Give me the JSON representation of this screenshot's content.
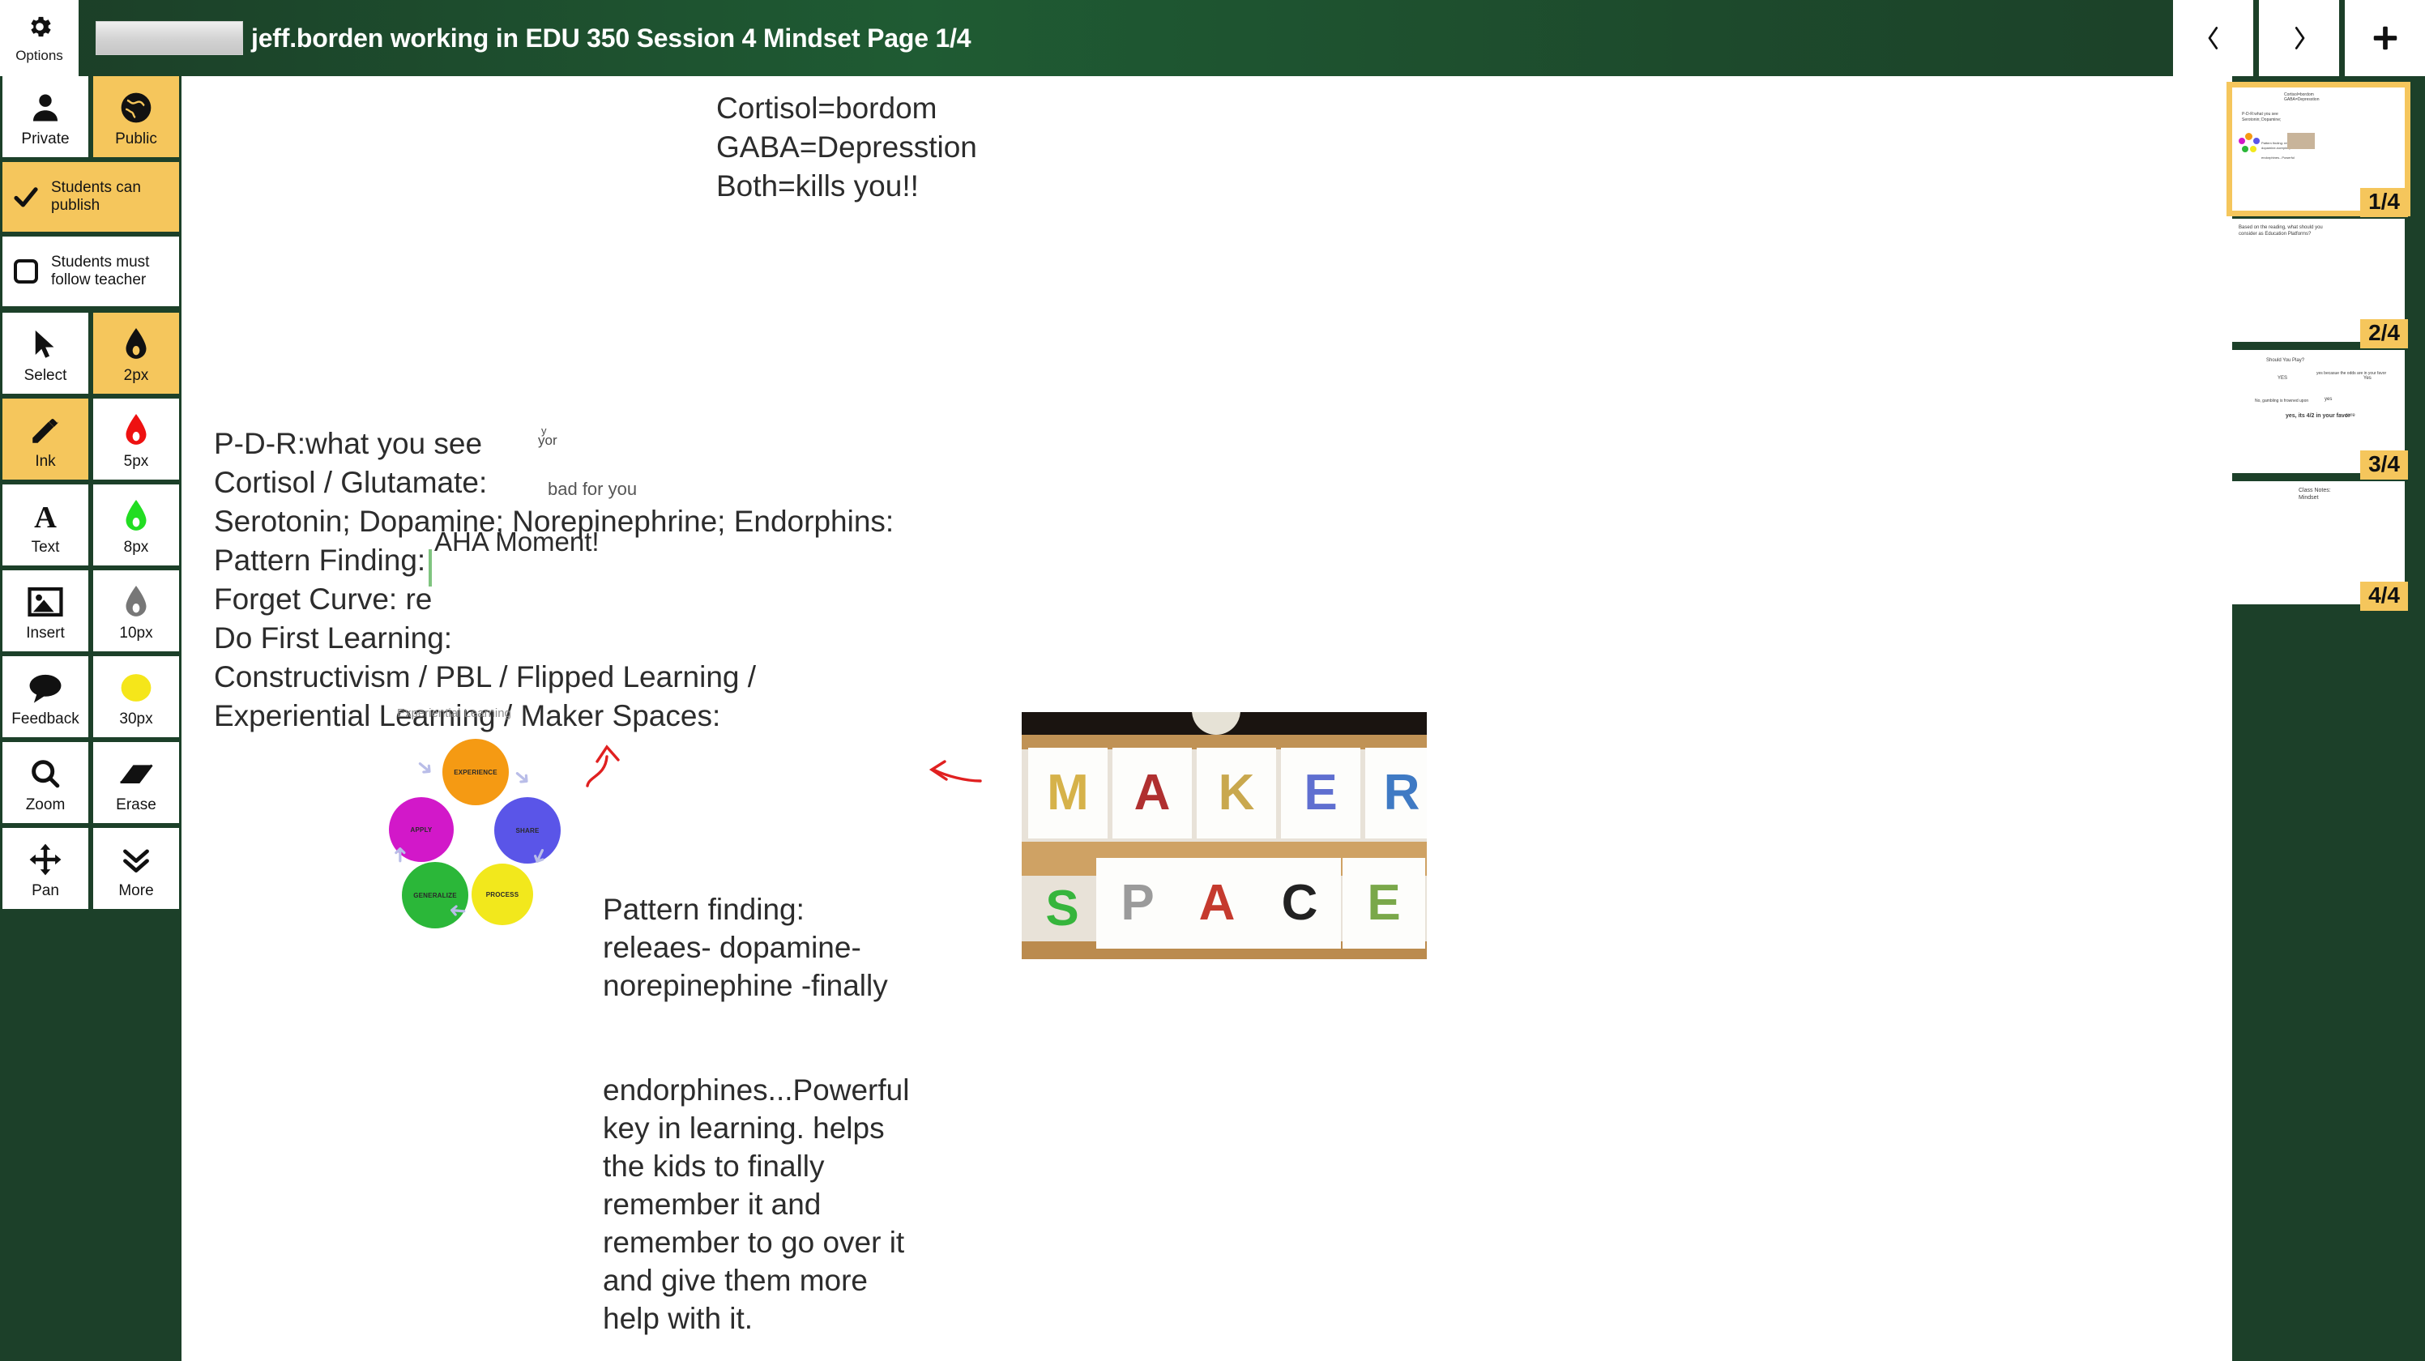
{
  "app": {
    "accent_yellow": "#f5c65c",
    "bg_green": "#1c4029",
    "canvas_white": "#ffffff"
  },
  "topbar": {
    "options_label": "Options",
    "options_icon": "gear-icon",
    "title": "jeff.borden working in EDU 350 Session 4 Mindset Page 1/4",
    "nav": {
      "prev_icon": "chevron-left-icon",
      "next_icon": "chevron-right-icon",
      "add_icon": "plus-icon"
    }
  },
  "toolpanel": {
    "visibility": [
      {
        "label": "Private",
        "icon": "person-icon",
        "active": false
      },
      {
        "label": "Public",
        "icon": "globe-icon",
        "active": true
      }
    ],
    "toggles": [
      {
        "label": "Students can publish",
        "icon": "checkmark-icon",
        "checked": true,
        "active": true
      },
      {
        "label": "Students must follow teacher",
        "icon": "empty-checkbox-icon",
        "checked": false,
        "active": false
      }
    ],
    "tools": [
      {
        "label": "Select",
        "icon": "cursor-arrow-icon",
        "active": false
      },
      {
        "label": "2px",
        "icon": "ink-drop-icon",
        "color": "#111111",
        "active": true
      },
      {
        "label": "Ink",
        "icon": "pencil-icon",
        "active": true
      },
      {
        "label": "5px",
        "icon": "ink-drop-icon",
        "color": "#ee1111",
        "active": false
      },
      {
        "label": "Text",
        "icon": "text-a-icon",
        "active": false
      },
      {
        "label": "8px",
        "icon": "ink-drop-icon",
        "color": "#22dd22",
        "active": false
      },
      {
        "label": "Insert",
        "icon": "image-icon",
        "active": false
      },
      {
        "label": "10px",
        "icon": "ink-drop-icon",
        "color": "#777777",
        "active": false
      },
      {
        "label": "Feedback",
        "icon": "speech-bubble-icon",
        "active": false
      },
      {
        "label": "30px",
        "icon": "ink-blob-icon",
        "color": "#f5e61a",
        "active": false
      },
      {
        "label": "Zoom",
        "icon": "magnifier-icon",
        "active": false
      },
      {
        "label": "Erase",
        "icon": "eraser-icon",
        "active": false
      },
      {
        "label": "Pan",
        "icon": "move-arrows-icon",
        "active": false
      },
      {
        "label": "More",
        "icon": "chevron-double-down-icon",
        "active": false
      }
    ]
  },
  "canvas": {
    "header_lines": [
      "Cortisol=bordom",
      "GABA=Depresstion",
      "Both=kills you!!"
    ],
    "note_lines": [
      "P-D-R:what you see",
      "Cortisol / Glutamate:",
      "Serotonin; Dopamine; Norepinephrine; Endorphins:",
      "Pattern Finding:",
      "Forget Curve: re",
      "Do First Learning:",
      "Constructivism / PBL / Flipped Learning /",
      "Experiential Learning / Maker Spaces:"
    ],
    "annotations": {
      "y_mark": "y",
      "yor_mark": "yor",
      "bad_for_you": "bad for you",
      "aha_moment": "AHA Moment!"
    },
    "cycle": {
      "title": "Experiential Learning",
      "nodes": [
        {
          "label": "EXPERIENCE",
          "color": "#f59a13"
        },
        {
          "label": "SHARE",
          "color": "#5a55e8"
        },
        {
          "label": "PROCESS",
          "color": "#f2e81c"
        },
        {
          "label": "GENERALIZE",
          "color": "#2bb739"
        },
        {
          "label": "APPLY",
          "color": "#d218c9"
        }
      ]
    },
    "photo": {
      "alt": "maker-space-letters-photo",
      "row1": [
        "M",
        "A",
        "K",
        "E",
        "R"
      ],
      "row2": [
        "S",
        "P",
        "A",
        "C",
        "E"
      ]
    },
    "paragraph_1": [
      "Pattern finding:",
      "releaes- dopamine-",
      "norepinephine  -finally"
    ],
    "paragraph_2": [
      "endorphines...Powerful",
      "key in learning. helps",
      "the kids to finally",
      "remember it and",
      "remember to go over it",
      "and give them more",
      "help with it."
    ]
  },
  "thumbnails": [
    {
      "badge": "1/4",
      "selected": true,
      "preview_lines": [
        "Cortisol=bordom",
        "GABA=Depresstion",
        "P-D-R:what you see",
        "Serotonin; Dopamine;",
        "Pattern finding: releaes-",
        "dopamine-norepinephine",
        "endorphines...Powerful"
      ]
    },
    {
      "badge": "2/4",
      "selected": false,
      "preview_lines": [
        "Based on the reading, what should you",
        "consider as Education Platforms?"
      ]
    },
    {
      "badge": "3/4",
      "selected": false,
      "preview_lines": [
        "Should You Play?",
        "YES",
        "yes becasue the odds are in your favor",
        "Yes",
        "No, gambling is frowned upon",
        "yes",
        "yes, its 4/2 in your favor",
        "sure"
      ]
    },
    {
      "badge": "4/4",
      "selected": false,
      "preview_lines": [
        "Class Notes:",
        "Mindset"
      ]
    }
  ]
}
